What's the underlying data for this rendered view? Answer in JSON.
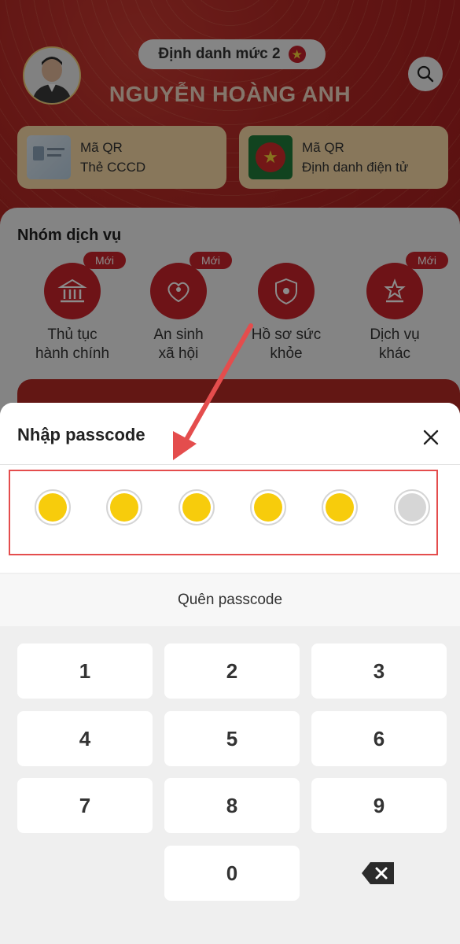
{
  "profile": {
    "level_label": "Định danh mức 2",
    "name": "NGUYỄN HOÀNG ANH"
  },
  "qr_cards": [
    {
      "line1": "Mã QR",
      "line2": "Thẻ CCCD"
    },
    {
      "line1": "Mã QR",
      "line2": "Định danh điện tử"
    }
  ],
  "services": {
    "title": "Nhóm dịch vụ",
    "new_label": "Mới",
    "items": [
      {
        "line1": "Thủ tục",
        "line2": "hành chính",
        "icon": "bank-icon",
        "new": true
      },
      {
        "line1": "An sinh",
        "line2": "xã hội",
        "icon": "family-icon",
        "new": true
      },
      {
        "line1": "Hồ sơ sức",
        "line2": "khỏe",
        "icon": "health-shield-icon",
        "new": false
      },
      {
        "line1": "Dịch vụ",
        "line2": "khác",
        "icon": "star-podium-icon",
        "new": true
      }
    ]
  },
  "passcode_sheet": {
    "title": "Nhập passcode",
    "forgot_label": "Quên passcode",
    "digits_filled": 5,
    "digits_total": 6
  },
  "keypad": {
    "keys": [
      "1",
      "2",
      "3",
      "4",
      "5",
      "6",
      "7",
      "8",
      "9",
      "0"
    ]
  },
  "colors": {
    "brand_red": "#c8242a",
    "dot_filled": "#f7cc0c",
    "dot_empty": "#d6d6d6",
    "annotation_red": "#e44d4d"
  }
}
